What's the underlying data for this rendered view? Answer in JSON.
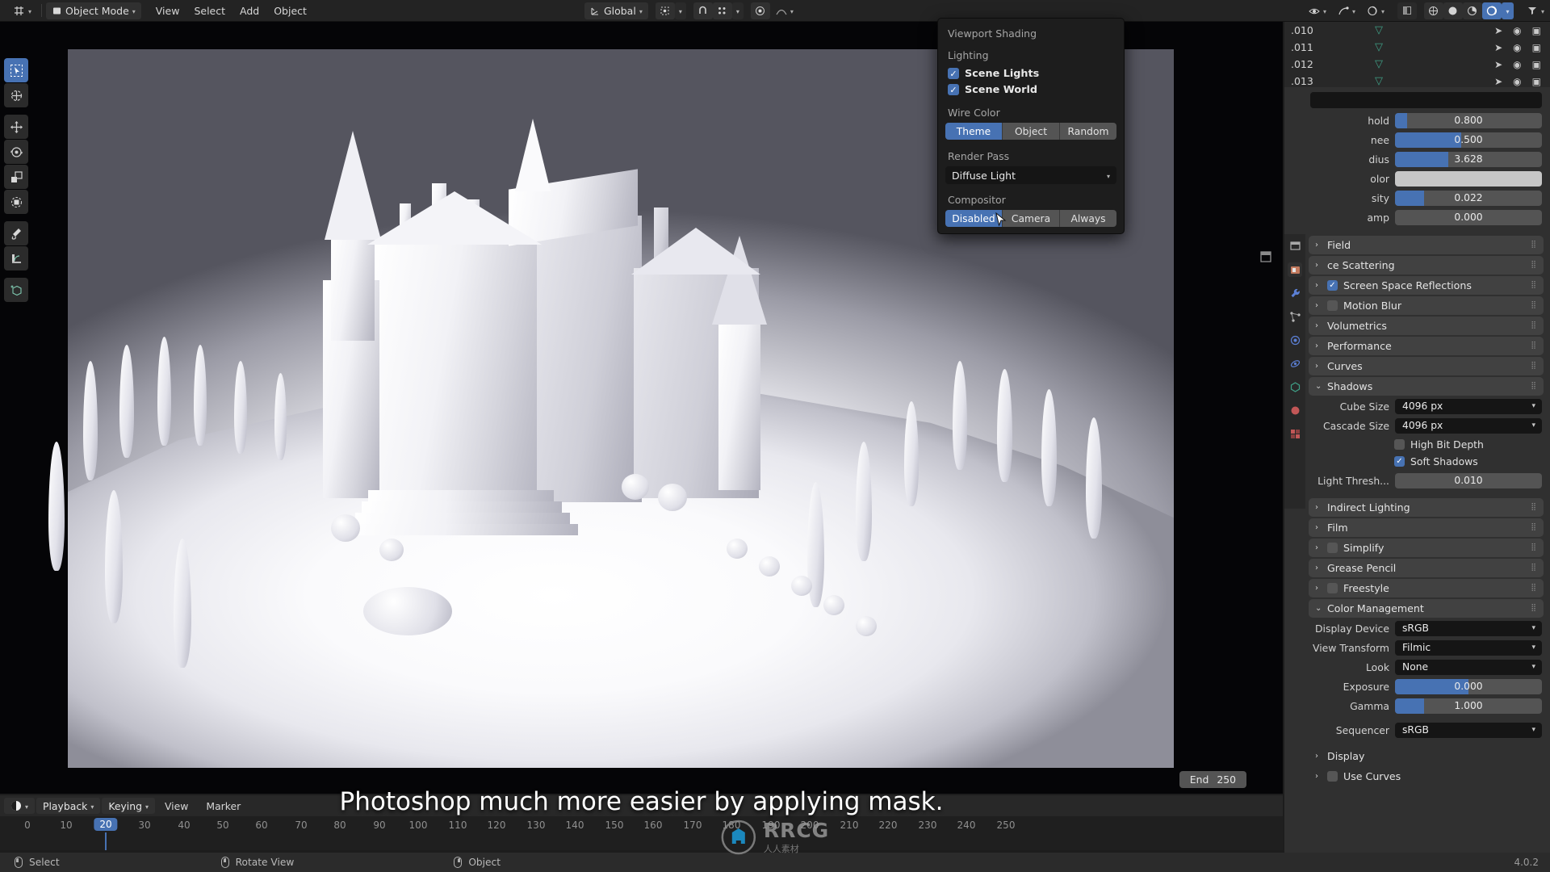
{
  "app": {
    "name": "Blender",
    "version": "4.0.2"
  },
  "topbar": {
    "editor_type_icon": "editor-type-icon",
    "mode": "Object Mode",
    "menus": [
      "View",
      "Select",
      "Add",
      "Object"
    ],
    "transform_orientation": "Global",
    "snapping_icon": "magnet-icon",
    "proportional_icon": "proportional-edit-icon",
    "shading_icons": [
      "wireframe-icon",
      "solid-icon",
      "material-preview-icon",
      "rendered-icon"
    ],
    "active_shading": "rendered"
  },
  "left_toolbar": {
    "tools": [
      {
        "name": "tweak-select-box",
        "icon": "cursor-box-icon",
        "active": true
      },
      {
        "name": "cursor",
        "icon": "crosshair-icon",
        "active": false
      },
      {
        "name": "move",
        "icon": "move-arrows-icon",
        "active": false
      },
      {
        "name": "rotate",
        "icon": "rotate-icon",
        "active": false
      },
      {
        "name": "scale",
        "icon": "scale-icon",
        "active": false
      },
      {
        "name": "transform",
        "icon": "transform-icon",
        "active": false
      },
      {
        "name": "annotate",
        "icon": "pencil-icon",
        "active": false
      },
      {
        "name": "measure",
        "icon": "ruler-icon",
        "active": false
      },
      {
        "name": "add-cube",
        "icon": "add-cube-icon",
        "active": false
      }
    ]
  },
  "shading_popup": {
    "title": "Viewport Shading",
    "lighting_label": "Lighting",
    "scene_lights": {
      "label": "Scene Lights",
      "checked": true
    },
    "scene_world": {
      "label": "Scene World",
      "checked": true
    },
    "wire_color_label": "Wire Color",
    "wire_color_options": [
      "Theme",
      "Object",
      "Random"
    ],
    "wire_color_selected": "Theme",
    "render_pass_label": "Render Pass",
    "render_pass_value": "Diffuse Light",
    "compositor_label": "Compositor",
    "compositor_options": [
      "Disabled",
      "Camera",
      "Always"
    ],
    "compositor_selected": "Disabled"
  },
  "outliner": {
    "rows": [
      {
        "name": ".010",
        "type_icon": "mesh-data-icon"
      },
      {
        "name": ".011",
        "type_icon": "mesh-data-icon"
      },
      {
        "name": ".012",
        "type_icon": "mesh-data-icon"
      },
      {
        "name": ".013",
        "type_icon": "mesh-data-icon"
      }
    ],
    "row_icons": [
      "restrict-select-icon",
      "hide-viewport-icon",
      "disable-render-icon"
    ]
  },
  "properties": {
    "tabs": [
      {
        "name": "tool",
        "icon": "tool-icon",
        "active": false
      },
      {
        "name": "render",
        "icon": "render-icon",
        "active": true
      },
      {
        "name": "output",
        "icon": "printer-icon",
        "active": false
      },
      {
        "name": "view-layer",
        "icon": "images-icon",
        "active": false
      },
      {
        "name": "scene",
        "icon": "scene-icon",
        "active": false
      },
      {
        "name": "world",
        "icon": "world-icon",
        "active": false
      },
      {
        "name": "object",
        "icon": "object-icon",
        "active": false
      },
      {
        "name": "modifiers",
        "icon": "wrench-icon",
        "active": false
      },
      {
        "name": "particles",
        "icon": "particles-icon",
        "active": false
      },
      {
        "name": "physics",
        "icon": "physics-icon",
        "active": false
      },
      {
        "name": "constraints",
        "icon": "constraints-icon",
        "active": false
      },
      {
        "name": "data",
        "icon": "data-icon",
        "active": false
      },
      {
        "name": "material",
        "icon": "material-icon",
        "active": false
      },
      {
        "name": "texture",
        "icon": "texture-icon",
        "active": false
      }
    ],
    "bloom": {
      "fields": [
        {
          "label": "Threshold",
          "label_clipped": "hold",
          "value": "0.800",
          "fill": 0.08
        },
        {
          "label": "Knee",
          "label_clipped": "nee",
          "value": "0.500",
          "fill": 0.45
        },
        {
          "label": "Radius",
          "label_clipped": "dius",
          "value": "3.628",
          "fill": 0.36
        },
        {
          "label": "Color",
          "label_clipped": "olor",
          "value": "",
          "fill": 1.0,
          "swatch": "#c6c6c6"
        },
        {
          "label": "Intensity",
          "label_clipped": "sity",
          "value": "0.022",
          "fill": 0.2
        },
        {
          "label": "Clamp",
          "label_clipped": "amp",
          "value": "0.000",
          "fill": 0
        }
      ]
    },
    "panels": [
      {
        "label": "Field",
        "label_clipped": "Field",
        "open": false,
        "checkbox": null
      },
      {
        "label": "Subsurface Scattering",
        "label_clipped": "ce Scattering",
        "open": false,
        "checkbox": null
      },
      {
        "label": "Screen Space Reflections",
        "open": false,
        "checkbox": true
      },
      {
        "label": "Motion Blur",
        "open": false,
        "checkbox": false
      },
      {
        "label": "Volumetrics",
        "open": false,
        "checkbox": null
      },
      {
        "label": "Performance",
        "open": false,
        "checkbox": null
      },
      {
        "label": "Curves",
        "open": false,
        "checkbox": null
      },
      {
        "label": "Shadows",
        "open": true,
        "checkbox": null
      }
    ],
    "shadows": {
      "cube_size": {
        "label": "Cube Size",
        "value": "4096 px"
      },
      "cascade_size": {
        "label": "Cascade Size",
        "value": "4096 px"
      },
      "high_bit_depth": {
        "label": "High Bit Depth",
        "checked": false
      },
      "soft_shadows": {
        "label": "Soft Shadows",
        "checked": true
      },
      "light_threshold": {
        "label": "Light Thresh...",
        "value": "0.010"
      }
    },
    "panels2": [
      {
        "label": "Indirect Lighting",
        "open": false,
        "checkbox": null
      },
      {
        "label": "Film",
        "open": false,
        "checkbox": null
      },
      {
        "label": "Simplify",
        "open": false,
        "checkbox": false
      },
      {
        "label": "Grease Pencil",
        "open": false,
        "checkbox": null
      },
      {
        "label": "Freestyle",
        "open": false,
        "checkbox": false
      },
      {
        "label": "Color Management",
        "open": true,
        "checkbox": null
      }
    ],
    "color_management": {
      "display_device": {
        "label": "Display Device",
        "value": "sRGB"
      },
      "view_transform": {
        "label": "View Transform",
        "value": "Filmic"
      },
      "look": {
        "label": "Look",
        "value": "None"
      },
      "exposure": {
        "label": "Exposure",
        "value": "0.000",
        "fill": 0.5
      },
      "gamma": {
        "label": "Gamma",
        "value": "1.000",
        "fill": 0.2
      },
      "sequencer": {
        "label": "Sequencer",
        "value": "sRGB"
      }
    },
    "panels3": [
      {
        "label": "Display",
        "open": false,
        "checkbox": null
      },
      {
        "label": "Use Curves",
        "open": false,
        "checkbox": false
      }
    ]
  },
  "timeline": {
    "playback": "Playback",
    "keying": "Keying",
    "menus": [
      "View",
      "Marker"
    ],
    "current_frame": "20",
    "end_label": "End",
    "end_value": "250",
    "ticks": [
      "0",
      "10",
      "20",
      "30",
      "40",
      "50",
      "60",
      "70",
      "80",
      "90",
      "100",
      "110",
      "120",
      "130",
      "140",
      "150",
      "160",
      "170",
      "180",
      "190",
      "200",
      "210",
      "220",
      "230",
      "240",
      "250"
    ]
  },
  "subtitle": {
    "text": "Photoshop much more easier by applying mask."
  },
  "watermark": {
    "text": "RRCG",
    "sub": "人人素材"
  },
  "statusbar": {
    "items": [
      {
        "icon": "mouse-left-icon",
        "label": "Select"
      },
      {
        "icon": "mouse-middle-icon",
        "label": "Rotate View"
      },
      {
        "icon": "mouse-right-icon",
        "label": "Object"
      }
    ],
    "version": "4.0.2"
  },
  "colors": {
    "accent": "#4772b3",
    "panel": "#303030",
    "header": "#232323",
    "field": "#545454",
    "dark_field": "#151515"
  }
}
